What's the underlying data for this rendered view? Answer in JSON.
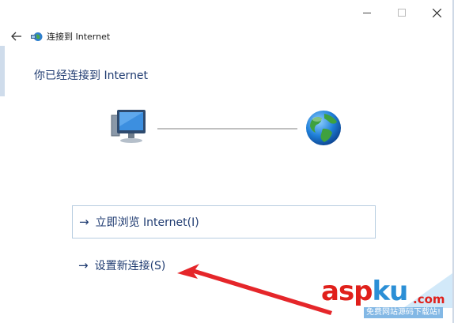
{
  "window": {
    "nav_title": "连接到 Internet",
    "controls": [
      "minimize",
      "maximize",
      "close"
    ]
  },
  "main": {
    "heading": "你已经连接到 Internet"
  },
  "connection_graphic": {
    "left_icon": "computer-monitor-icon",
    "right_icon": "globe-icon"
  },
  "options": [
    {
      "arrow": "→",
      "label": "立即浏览 Internet(I)"
    },
    {
      "arrow": "→",
      "label": "设置新连接(S)"
    }
  ],
  "watermark": {
    "brand_red": "asp",
    "brand_blue": "ku",
    "dot": ".com",
    "subtext": "免费网站源码下载站!"
  },
  "colors": {
    "heading_text": "#1e3a70",
    "option_border": "#b7cde0",
    "annotation_arrow": "#e5262a",
    "watermark_red": "#e0201b",
    "watermark_blue": "#2b8fd6"
  }
}
